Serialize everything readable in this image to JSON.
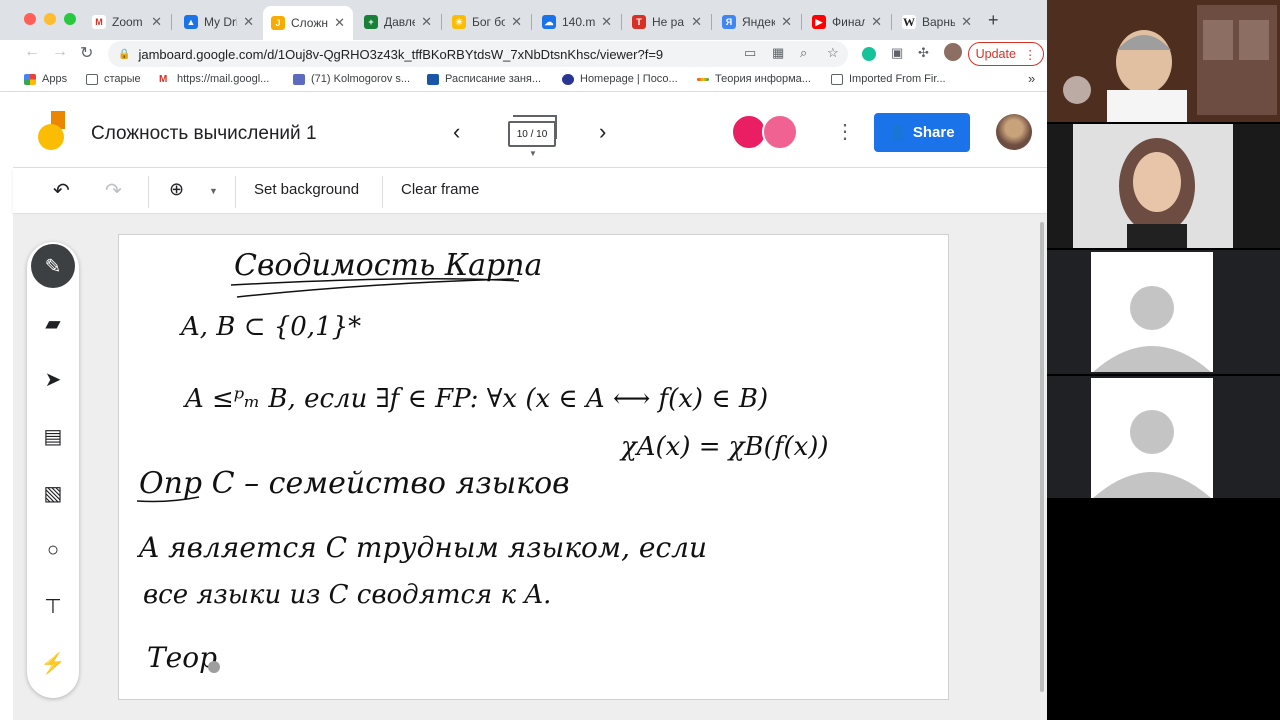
{
  "browser": {
    "tabs": [
      {
        "label": "Zoom",
        "icon": "gmail-icon",
        "color": "#d93025"
      },
      {
        "label": "My Dri",
        "icon": "drive-icon",
        "color": "#1a73e8"
      },
      {
        "label": "Сложн",
        "icon": "jamboard-icon",
        "color": "#f9ab00"
      },
      {
        "label": "Давле",
        "icon": "sheets-icon",
        "color": "#188038"
      },
      {
        "label": "Бог бо",
        "icon": "sun-icon",
        "color": "#fbbc04"
      },
      {
        "label": "140.m",
        "icon": "cloud-icon",
        "color": "#1a73e8"
      },
      {
        "label": "Не ра",
        "icon": "book-icon",
        "color": "#d93025"
      },
      {
        "label": "Яндек",
        "icon": "yandex-icon",
        "color": "#4285f4"
      },
      {
        "label": "Финал",
        "icon": "youtube-icon",
        "color": "#ff0000"
      },
      {
        "label": "Варнь",
        "icon": "wikipedia-icon",
        "color": "#202124"
      }
    ],
    "url": "jamboard.google.com/d/1Ouj8v-QgRHO3z43k_tffBKoRBYtdsW_7xNbDtsnKhsc/viewer?f=9",
    "update_label": "Update",
    "bookmarks": [
      {
        "label": "Apps"
      },
      {
        "label": "старые"
      },
      {
        "label": "https://mail.googl..."
      },
      {
        "label": "(71) Kolmogorov s..."
      },
      {
        "label": "Расписание заня..."
      },
      {
        "label": "Homepage | Посо..."
      },
      {
        "label": "Теория информа..."
      },
      {
        "label": "Imported From Fir..."
      }
    ],
    "bookmarks_more": "»"
  },
  "jamboard": {
    "title": "Сложность вычислений 1",
    "frame_counter": "10 / 10",
    "share_label": "Share",
    "toolbar": {
      "set_background": "Set background",
      "clear_frame": "Clear frame"
    },
    "tools": [
      "pen-icon",
      "eraser-icon",
      "select-icon",
      "sticky-note-icon",
      "image-icon",
      "circle-icon",
      "textbox-icon",
      "laser-icon"
    ]
  },
  "handwriting": {
    "title": "Сводимость Карпа",
    "line1": "A, B ⊂ {0,1}*",
    "line2": "A ≤ᵖₘ B, если ∃f ∈ FP: ∀x (x ∈ A ⟷ f(x) ∈ B)",
    "line3": "χA(x) = χB(f(x))",
    "line4": "Опр C – семейство языков",
    "line5": "A является C трудным языком, если",
    "line6": "все языки из C сводятся к A.",
    "line7": "Теор"
  },
  "colors": {
    "accent": "#1a73e8",
    "update": "#d93025",
    "ink": "#111111"
  }
}
